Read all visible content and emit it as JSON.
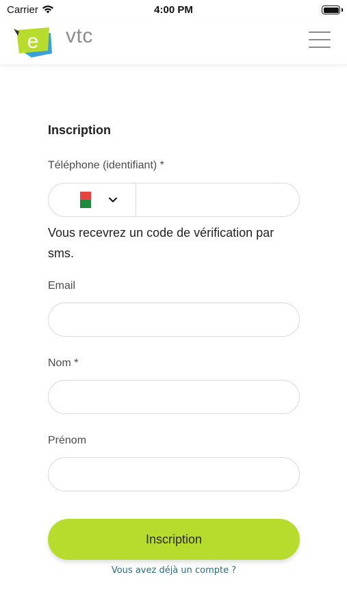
{
  "status_bar": {
    "carrier": "Carrier",
    "time": "4:00 PM",
    "wifi_icon": "wifi-icon",
    "battery_icon": "battery-icon"
  },
  "header": {
    "logo_text": "vtc",
    "logo_letter": "e",
    "menu_icon": "hamburger-menu-icon",
    "colors": {
      "logo_green": "#b8dc2e",
      "logo_blue": "#3aa0d8",
      "logo_text": "#8c8c8c"
    }
  },
  "form": {
    "title": "Inscription",
    "phone": {
      "label": "Téléphone (identifiant) *",
      "country_flag": "madagascar-flag-icon",
      "value": ""
    },
    "hint": "Vous recevrez un code de vérification par sms.",
    "email": {
      "label": "Email",
      "value": ""
    },
    "nom": {
      "label": "Nom *",
      "value": ""
    },
    "prenom": {
      "label": "Prénom",
      "value": ""
    },
    "submit_label": "Inscription",
    "login_link": "Vous avez déjà un compte ?",
    "colors": {
      "accent": "#b8dc2e",
      "link": "#2d6b7a",
      "border": "#d9d9d9"
    }
  }
}
